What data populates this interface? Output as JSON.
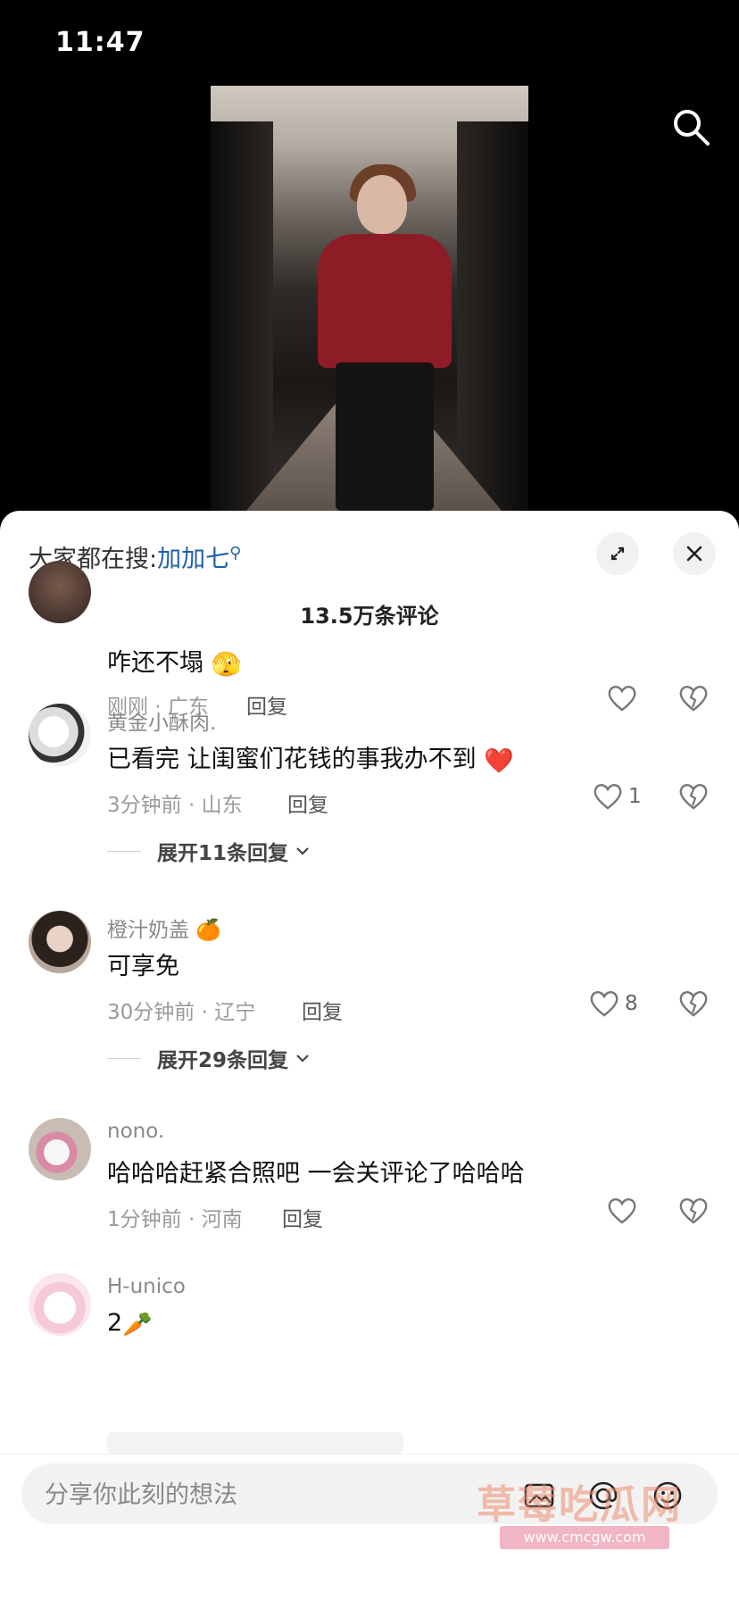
{
  "status_bar": {
    "time": "11:47"
  },
  "panel": {
    "hot_search_prefix": "大家都在搜:",
    "hot_search_keyword": "加加七",
    "comment_count": "13.5万条评论"
  },
  "comments": [
    {
      "username": "",
      "text": "咋还不塌",
      "emoji": "🫣",
      "meta": "刚刚 · 广东",
      "reply": "回复",
      "likes": ""
    },
    {
      "username": "黄金小酥肉.",
      "text": "已看完 让闺蜜们花钱的事我办不到",
      "emoji": "❤️",
      "meta": "3分钟前 · 山东",
      "reply": "回复",
      "likes": "1",
      "expand": "展开11条回复"
    },
    {
      "username": "橙汁奶盖",
      "username_emoji": "🍊",
      "text": "可享免",
      "meta": "30分钟前 · 辽宁",
      "reply": "回复",
      "likes": "8",
      "expand": "展开29条回复"
    },
    {
      "username": "nono.",
      "text": "哈哈哈赶紧合照吧 一会关评论了哈哈哈",
      "meta": "1分钟前 · 河南",
      "reply": "回复",
      "likes": ""
    },
    {
      "username": "H-unico",
      "text": "2",
      "emoji": "🥕"
    }
  ],
  "input": {
    "placeholder": "分享你此刻的想法"
  },
  "watermark": {
    "text": "草莓吃瓜网",
    "url": "www.cmcgw.com"
  },
  "colors": {
    "accent_link": "#1f5fa9",
    "heart_red": "#f0364f",
    "panel_bg": "#ffffff"
  },
  "icons": [
    "search-icon",
    "expand-icon",
    "close-icon",
    "heart-icon",
    "broken-heart-icon",
    "chevron-down-icon",
    "image-icon",
    "at-icon",
    "emoji-icon"
  ]
}
